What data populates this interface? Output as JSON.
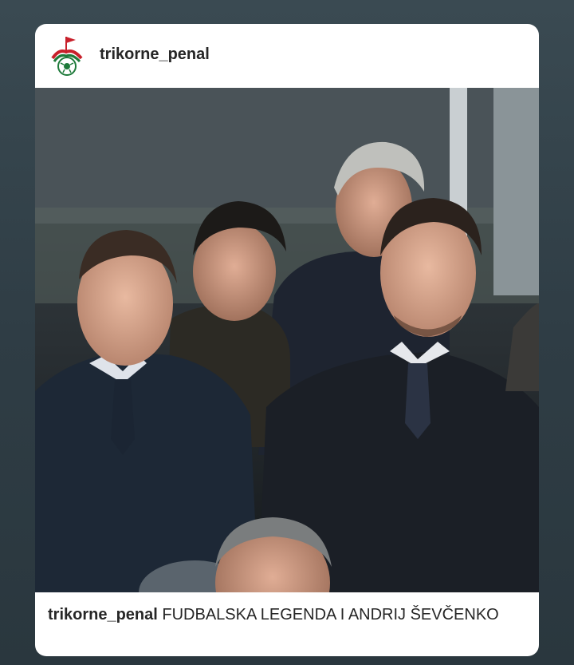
{
  "post": {
    "username": "trikorne_penal",
    "logo_icon": "club-crest-icon",
    "photo_description_icon": "photo",
    "caption_user": "trikorne_penal",
    "caption_text": " FUDBALSKA LEGENDA I ANDRIJ ŠEVČENKO"
  },
  "colors": {
    "background": "#34444c",
    "card": "#ffffff",
    "text": "#262626",
    "crest_red": "#c8202b",
    "crest_green": "#1e7a3a"
  }
}
